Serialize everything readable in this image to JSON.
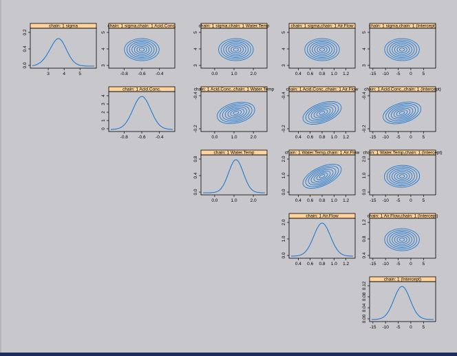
{
  "colors": {
    "background": "#c8c8cc",
    "strip": "#ffd39b",
    "curve": "#1e78d2",
    "frame": "#1c2c5c"
  },
  "chart_data": {
    "type": "density-pairs",
    "grid": false,
    "variables": [
      {
        "id": "sigma",
        "label": "chain: 1 sigma",
        "ticks": [
          3,
          4,
          5
        ],
        "ticks_shown": [
          3,
          4,
          5
        ],
        "range": [
          2.0,
          5.9
        ],
        "center": 3.5,
        "sd": 0.55,
        "skew": 0.3,
        "density_ticks": [
          "0.0",
          "0.4",
          "0.2"
        ],
        "density_tick_values": [
          0.0,
          0.4,
          0.8
        ],
        "density_max": 0.74
      },
      {
        "id": "acid",
        "label": "chain: 1 Acid.Conc.",
        "ticks": [
          -0.8,
          -0.6,
          -0.4
        ],
        "ticks_shown": [
          "-0.8",
          "-0.6",
          "-0.4"
        ],
        "range": [
          -0.95,
          -0.25
        ],
        "center": -0.6,
        "sd": 0.1,
        "skew": 0,
        "density_ticks": [
          "0",
          "1",
          "2",
          "3",
          "4"
        ],
        "density_tick_values": [
          0,
          1,
          2,
          3,
          4
        ],
        "density_max": 4.2
      },
      {
        "id": "water",
        "label": "chain: 1 Water.Temp",
        "ticks": [
          0.0,
          1.0,
          2.0
        ],
        "ticks_shown": [
          "0.0",
          "1.0",
          "2.0"
        ],
        "range": [
          -0.6,
          2.6
        ],
        "center": 1.1,
        "sd": 0.38,
        "skew": 0,
        "density_ticks": [
          "0.0",
          "0.4",
          "0.8"
        ],
        "density_tick_values": [
          0.0,
          0.4,
          0.8
        ],
        "density_max": 1.05
      },
      {
        "id": "air",
        "label": "chain: 1 Air.Flow",
        "ticks": [
          0.4,
          0.6,
          0.8,
          1.0,
          1.2
        ],
        "ticks_shown": [
          "0.4",
          "0.6",
          "0.8",
          "1.0",
          "1.2"
        ],
        "range": [
          0.28,
          1.32
        ],
        "center": 0.8,
        "sd": 0.14,
        "skew": 0,
        "density_ticks": [
          "0.0",
          "1.0",
          "2.0"
        ],
        "density_tick_values": [
          0.0,
          1.0,
          2.0
        ],
        "density_max": 2.85
      },
      {
        "id": "intercept",
        "label": "chain: 1 (Intercept)",
        "ticks": [
          -15,
          -10,
          -5,
          0,
          5
        ],
        "ticks_shown": [
          "-15",
          "-10",
          "-5",
          "0",
          "5"
        ],
        "range": [
          -15.5,
          9.0
        ],
        "center": -3.5,
        "sd": 3.2,
        "skew": 0,
        "density_ticks": [
          "0.00",
          "0.04",
          "0.08",
          "0.12"
        ],
        "density_tick_values": [
          0.0,
          0.04,
          0.08,
          0.12
        ],
        "density_max": 0.125
      }
    ],
    "pair_labels": {
      "0-1": "chain: 1 sigma,chain: 1 Acid.Conc.",
      "0-2": "chain: 1 sigma,chain: 1 Water.Temp",
      "0-3": "chain: 1 sigma,chain: 1 Air.Flow",
      "0-4": "chain: 1 sigma,chain: 1 (Intercept)",
      "1-2": "chain: 1 Acid.Conc.,chain: 1 Water.Temp",
      "1-3": "chain: 1 Acid.Conc.,chain: 1 Air.Flow",
      "1-4": "chain: 1 Acid.Conc.,chain: 1 (Intercept)",
      "2-3": "chain: 1 Water.Temp,chain: 1 Air.Flow",
      "2-4": "chain: 1 Water.Temp,chain: 1 (Intercept)",
      "3-4": "chain: 1 Air.Flow,chain: 1 (Intercept)"
    },
    "pair_y_ticks": {
      "0": [
        "3",
        "4",
        "5"
      ],
      "1": [
        "-0.2",
        "-0.4"
      ],
      "2": [
        "0.0",
        "1.0",
        "2.0"
      ],
      "3": [
        "0.4",
        "0.8",
        "1.2"
      ]
    },
    "correlations": {
      "0-1": 0.0,
      "0-2": 0.0,
      "0-3": 0.0,
      "0-4": 0.0,
      "1-2": -0.3,
      "1-3": -0.45,
      "1-4": -0.35,
      "2-3": -0.55,
      "2-4": -0.05,
      "3-4": 0.0
    }
  }
}
